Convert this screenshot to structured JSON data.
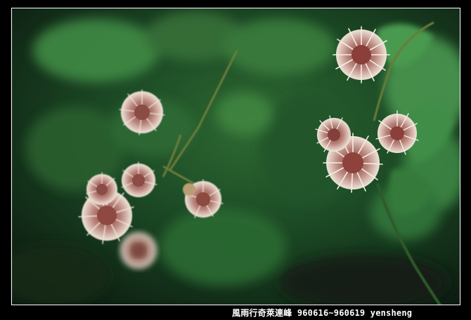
{
  "caption": {
    "text": "風雨行奇萊連峰 960616~960619 yensheng"
  },
  "colors": {
    "frame": "#000000",
    "border": "#ffffff",
    "foliage_dark": "#0f2a16",
    "foliage_mid": "#2e6b35",
    "foliage_light": "#4f9a52",
    "flower_white": "#f2ece4",
    "flower_pink": "#b05a5a"
  }
}
